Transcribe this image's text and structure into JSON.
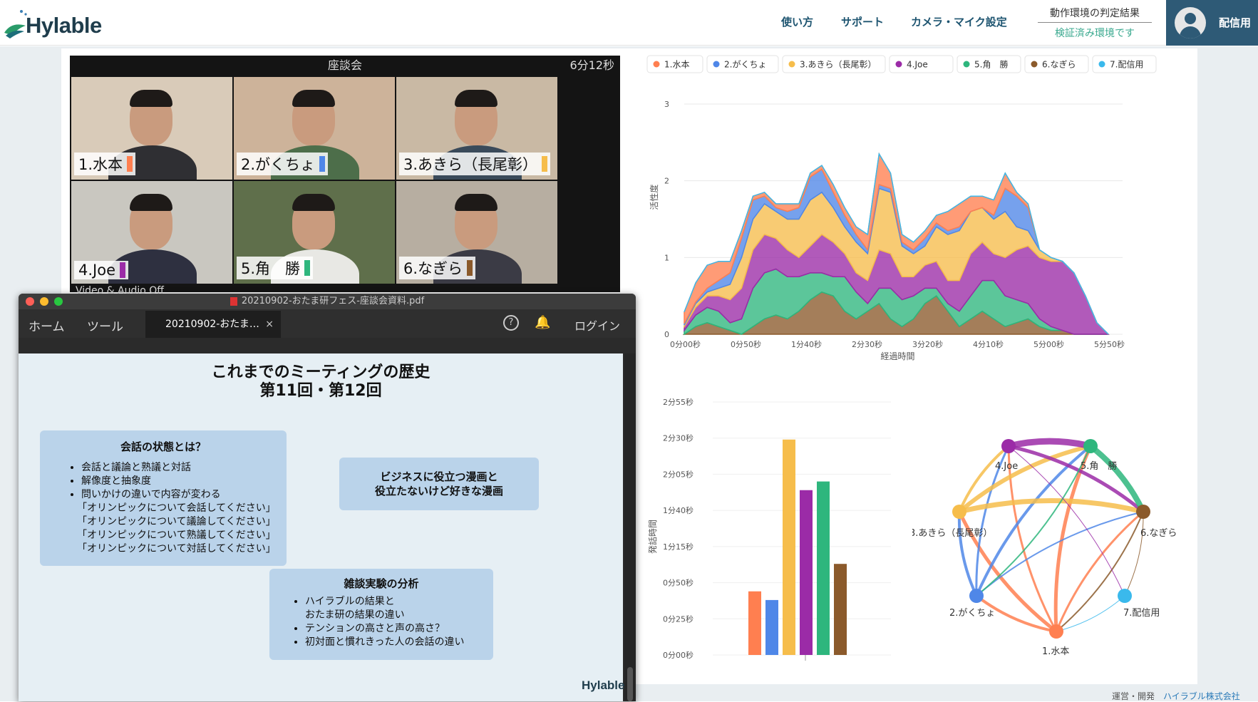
{
  "app": {
    "logo": "Hylable"
  },
  "nav": {
    "items": [
      "使い方",
      "サポート",
      "カメラ・マイク設定"
    ]
  },
  "status": {
    "label": "動作環境の判定結果",
    "value": "検証済み環境です"
  },
  "user": {
    "label": "配信用"
  },
  "video": {
    "title": "座談会",
    "elapsed": "6分12秒",
    "overlay": "Video & Audio Off",
    "participants": [
      {
        "name": "1.水本",
        "color": "#ff7f50"
      },
      {
        "name": "2.がくちょ",
        "color": "#4f87e8"
      },
      {
        "name": "3.あきら（長尾彰）",
        "color": "#f6bd4b"
      },
      {
        "name": "4.Joe",
        "color": "#9b2ba7"
      },
      {
        "name": "5.角　勝",
        "color": "#2eb67d"
      },
      {
        "name": "6.なぎら",
        "color": "#8b5a2b"
      }
    ]
  },
  "pdf": {
    "filename": "20210902-おたま研フェス-座談会資料.pdf",
    "toolbar": {
      "home": "ホーム",
      "tools": "ツール",
      "tab": "20210902-おたま…",
      "login": "ログイン"
    },
    "slide": {
      "title_line1": "これまでのミーティングの歴史",
      "title_line2": "第11回・第12回",
      "box1": {
        "heading": "会話の状態とは？",
        "bullets": [
          "会話と議論と熟議と対話",
          "解像度と抽象度",
          "問いかけの違いで内容が変わる"
        ],
        "quotes": [
          "「オリンピックについて会話してください」",
          "「オリンピックについて議論してください」",
          "「オリンピックについて熟議してください」",
          "「オリンピックについて対話してください」"
        ]
      },
      "box2": {
        "line1": "ビジネスに役立つ漫画と",
        "line2": "役立たないけど好きな漫画"
      },
      "box3": {
        "heading": "雑談実験の分析",
        "bullets": [
          "ハイラブルの結果と",
          "おたま研の結果の違い",
          "テンションの高さと声の高さ？",
          "初対面と慣れきった人の会話の違い"
        ]
      },
      "logo": "Hylable"
    }
  },
  "legend": [
    "1.水本",
    "2.がくちょ",
    "3.あきら（長尾彰）",
    "4.Joe",
    "5.角　勝",
    "6.なぎら",
    "7.配信用"
  ],
  "colors": [
    "#ff7f50",
    "#4f87e8",
    "#f6bd4b",
    "#9b2ba7",
    "#2eb67d",
    "#8b5a2b",
    "#3ab9ec"
  ],
  "chart_data": [
    {
      "type": "area",
      "ylabel": "活性度",
      "xlabel": "経過時間",
      "ylim": [
        0,
        3
      ],
      "yticks": [
        "0",
        "1",
        "2",
        "3"
      ],
      "xticks": [
        "0分00秒",
        "0分50秒",
        "1分40秒",
        "2分30秒",
        "3分20秒",
        "4分10秒",
        "5分00秒",
        "5分50秒"
      ],
      "x": [
        0,
        10,
        20,
        30,
        40,
        50,
        60,
        70,
        80,
        90,
        100,
        110,
        120,
        130,
        140,
        150,
        160,
        170,
        180,
        190,
        200,
        210,
        220,
        230,
        240,
        250,
        260,
        270,
        280,
        290,
        300,
        310,
        320,
        330,
        340,
        350,
        360,
        370
      ],
      "series": [
        {
          "name": "6.なぎら",
          "values": [
            0,
            0.1,
            0.15,
            0.1,
            0.05,
            0,
            0.1,
            0.2,
            0.25,
            0.2,
            0.3,
            0.45,
            0.55,
            0.5,
            0.3,
            0.2,
            0.3,
            0.4,
            0.2,
            0.1,
            0.2,
            0.4,
            0.5,
            0.3,
            0.1,
            0.2,
            0.3,
            0.2,
            0.1,
            0.15,
            0.2,
            0.1,
            0.05,
            0.05,
            0,
            0,
            0,
            0
          ]
        },
        {
          "name": "5.角　勝",
          "values": [
            0.05,
            0.15,
            0.2,
            0.2,
            0.1,
            0.2,
            0.5,
            0.6,
            0.6,
            0.55,
            0.45,
            0.35,
            0.25,
            0.25,
            0.45,
            0.35,
            0.1,
            0.2,
            0.4,
            0.35,
            0.3,
            0.2,
            0.1,
            0.1,
            0.2,
            0.3,
            0.4,
            0.5,
            0.4,
            0.3,
            0.2,
            0.1,
            0.05,
            0,
            0,
            0,
            0,
            0
          ]
        },
        {
          "name": "4.Joe",
          "values": [
            0.05,
            0.1,
            0.15,
            0.2,
            0.3,
            0.4,
            0.5,
            0.5,
            0.4,
            0.35,
            0.25,
            0.35,
            0.5,
            0.45,
            0.3,
            0.25,
            0.3,
            0.5,
            0.45,
            0.3,
            0.25,
            0.3,
            0.35,
            0.3,
            0.4,
            0.55,
            0.5,
            0.35,
            0.5,
            0.65,
            0.75,
            0.8,
            0.85,
            0.9,
            0.8,
            0.5,
            0.15,
            0
          ]
        },
        {
          "name": "3.あきら（長尾彰）",
          "values": [
            0.02,
            0.05,
            0.05,
            0.1,
            0.2,
            0.4,
            0.4,
            0.4,
            0.35,
            0.4,
            0.5,
            0.6,
            0.55,
            0.45,
            0.35,
            0.4,
            0.35,
            0.8,
            0.8,
            0.4,
            0.3,
            0.25,
            0.45,
            0.6,
            0.65,
            0.55,
            0.45,
            0.45,
            0.6,
            0.3,
            0.2,
            0.1,
            0.05,
            0,
            0,
            0,
            0,
            0
          ]
        },
        {
          "name": "2.がくちょ",
          "values": [
            0.02,
            0.02,
            0.05,
            0.1,
            0.15,
            0.25,
            0.25,
            0.1,
            0.05,
            0.1,
            0.15,
            0.3,
            0.3,
            0.2,
            0.15,
            0.1,
            0.05,
            0.05,
            0.05,
            0.05,
            0.05,
            0.1,
            0.05,
            0.05,
            0.05,
            0,
            0,
            0.05,
            0.3,
            0.4,
            0.3,
            0,
            0,
            0,
            0,
            0,
            0,
            0
          ]
        },
        {
          "name": "1.水本",
          "values": [
            0.15,
            0.25,
            0.3,
            0.25,
            0.15,
            0.1,
            0.05,
            0.05,
            0.05,
            0.1,
            0.05,
            0.05,
            0.05,
            0.1,
            0.1,
            0.1,
            0.2,
            0.4,
            0.2,
            0.1,
            0.1,
            0.1,
            0.1,
            0.25,
            0.3,
            0.2,
            0.15,
            0.2,
            0.2,
            0.05,
            0.05,
            0,
            0,
            0,
            0,
            0,
            0,
            0
          ]
        },
        {
          "name": "7.配信用",
          "values": [
            0,
            0,
            0,
            0,
            0,
            0,
            0,
            0,
            0,
            0,
            0,
            0,
            0,
            0,
            0,
            0,
            0,
            0,
            0,
            0,
            0,
            0,
            0,
            0,
            0,
            0,
            0,
            0,
            0,
            0,
            0,
            0,
            0,
            0,
            0,
            0,
            0,
            0
          ]
        }
      ]
    },
    {
      "type": "bar",
      "ylabel": "発話時間",
      "yticks": [
        "0分00秒",
        "0分25秒",
        "0分50秒",
        "1分15秒",
        "1分40秒",
        "2分05秒",
        "2分30秒",
        "2分55秒"
      ],
      "ylim": [
        0,
        175
      ],
      "categories": [
        "1.水本",
        "2.がくちょ",
        "3.あきら（長尾彰）",
        "4.Joe",
        "5.角　勝",
        "6.なぎら"
      ],
      "values": [
        44,
        38,
        149,
        114,
        120,
        63
      ]
    }
  ],
  "network": {
    "nodes": [
      "1.水本",
      "2.がくちょ",
      "3.あきら（長尾彰）",
      "4.Joe",
      "5.角　勝",
      "6.なぎら",
      "7.配信用"
    ]
  },
  "footer": {
    "prefix": "運営・開発",
    "company": "ハイラブル株式会社"
  }
}
